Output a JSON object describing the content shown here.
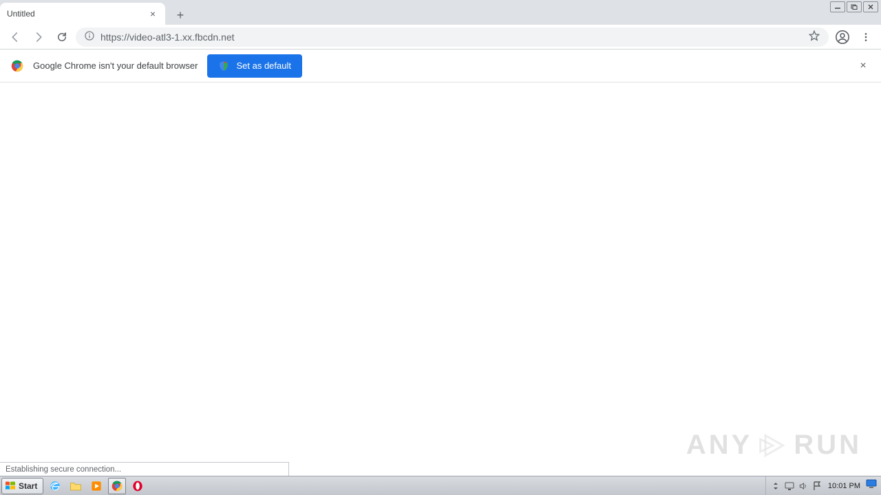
{
  "tab": {
    "title": "Untitled"
  },
  "address_bar": {
    "url_display": "https://video-atl3-1.xx.fbcdn.net"
  },
  "infobar": {
    "message": "Google Chrome isn't your default browser",
    "button_label": "Set as default"
  },
  "status_text": "Establishing secure connection...",
  "watermark": {
    "left": "ANY",
    "right": "RUN"
  },
  "taskbar": {
    "start_label": "Start",
    "clock": "10:01 PM"
  }
}
